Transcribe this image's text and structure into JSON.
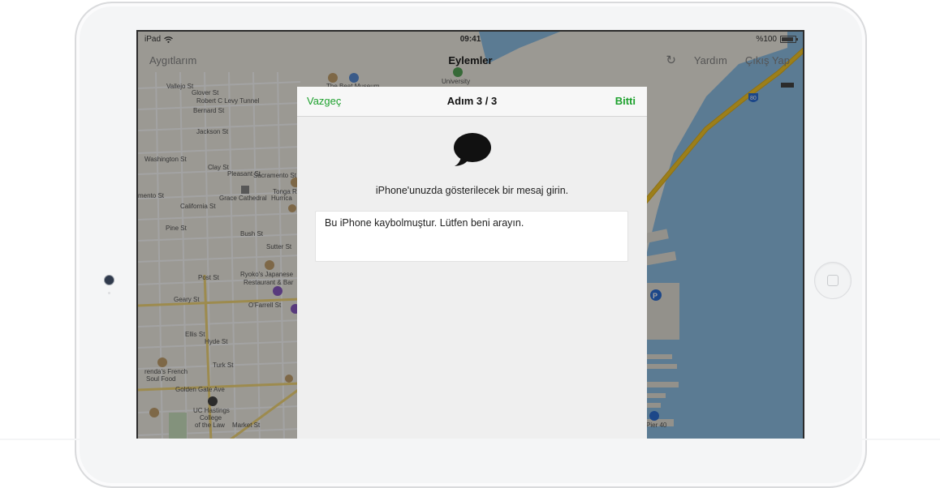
{
  "status_bar": {
    "device": "iPad",
    "time": "09:41",
    "battery": "%100"
  },
  "nav_bar": {
    "left": "Aygıtlarım",
    "title": "Eylemler",
    "help": "Yardım",
    "sign_out": "Çıkış Yap"
  },
  "dialog": {
    "cancel": "Vazgeç",
    "title": "Adım 3 / 3",
    "done": "Bitti",
    "prompt": "iPhone'unuzda gösterilecek bir mesaj girin.",
    "message_value": "Bu iPhone kaybolmuştur. Lütfen beni arayın."
  },
  "map": {
    "streets": [
      "Vallejo St",
      "Glover St",
      "Robert C Levy Tunnel",
      "Bernard St",
      "Jackson St",
      "Washington St",
      "Clay St",
      "Pleasant St",
      "Sacramento St",
      "mento St",
      "California St",
      "Pine St",
      "Bush St",
      "Sutter St",
      "Post St",
      "Geary St",
      "O'Farrell St",
      "Ellis St",
      "Hyde St",
      "Turk St",
      "Golden Gate Ave",
      "Market St"
    ],
    "places": [
      "The Beat Museum",
      "University",
      "Grace Cathedral",
      "Hurrica",
      "Tonga R",
      "Ryoko's Japanese",
      "Restaurant & Bar",
      "renda's French",
      "Soul Food",
      "UC Hastings",
      "College",
      "of the Law",
      "Pier 40"
    ],
    "highway_shield": "80",
    "parking_label": "P"
  },
  "colors": {
    "accent": "#1ea12e",
    "water": "#8fc0e6",
    "land": "#f2efe6",
    "highway": "#f5c72a"
  }
}
